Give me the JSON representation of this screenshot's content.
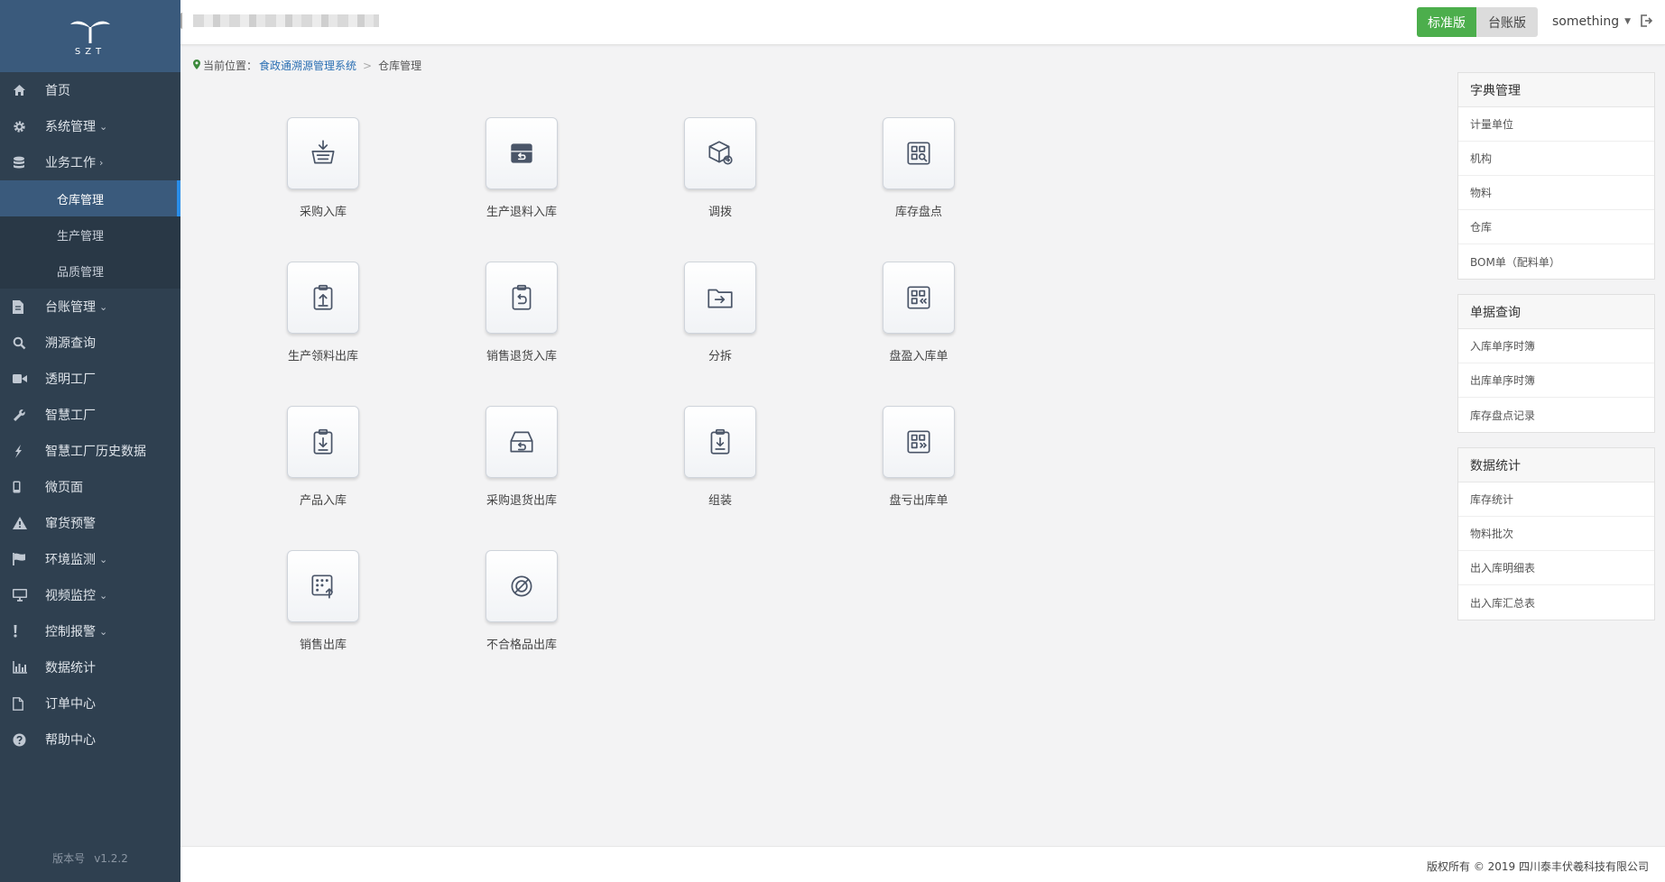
{
  "logo": {
    "text": "SZT"
  },
  "sidebar": {
    "items": [
      {
        "label": "首页",
        "icon": "home-icon",
        "arrow": ""
      },
      {
        "label": "系统管理",
        "icon": "gear-icon",
        "arrow": "⌄"
      },
      {
        "label": "业务工作",
        "icon": "database-icon",
        "arrow": "›"
      },
      {
        "label": "仓库管理",
        "sub": true,
        "active": true
      },
      {
        "label": "生产管理",
        "sub": true
      },
      {
        "label": "品质管理",
        "sub": true
      },
      {
        "label": "台账管理",
        "icon": "file-icon",
        "arrow": "⌄"
      },
      {
        "label": "溯源查询",
        "icon": "search-icon",
        "arrow": ""
      },
      {
        "label": "透明工厂",
        "icon": "video-icon",
        "arrow": ""
      },
      {
        "label": "智慧工厂",
        "icon": "wrench-icon",
        "arrow": ""
      },
      {
        "label": "智慧工厂历史数据",
        "icon": "flash-icon",
        "arrow": ""
      },
      {
        "label": "微页面",
        "icon": "mobile-icon",
        "arrow": ""
      },
      {
        "label": "窜货预警",
        "icon": "warning-icon",
        "arrow": ""
      },
      {
        "label": "环境监测",
        "icon": "flag-icon",
        "arrow": "⌄"
      },
      {
        "label": "视频监控",
        "icon": "monitor-icon",
        "arrow": "⌄"
      },
      {
        "label": "控制报警",
        "icon": "exclamation-icon",
        "arrow": "⌄"
      },
      {
        "label": "数据统计",
        "icon": "bar-chart-icon",
        "arrow": ""
      },
      {
        "label": "订单中心",
        "icon": "document-icon",
        "arrow": ""
      },
      {
        "label": "帮助中心",
        "icon": "help-icon",
        "arrow": ""
      }
    ],
    "version_label": "版本号",
    "version": "v1.2.2"
  },
  "header": {
    "standard_btn": "标准版",
    "ledger_btn": "台账版",
    "user": "something"
  },
  "breadcrumb": {
    "prefix": "当前位置：",
    "root": "食政通溯源管理系统",
    "separator": ">",
    "current": "仓库管理"
  },
  "tiles": [
    {
      "label": "采购入库",
      "icon": "basket-in-icon"
    },
    {
      "label": "生产退料入库",
      "icon": "inbox-return-icon"
    },
    {
      "label": "调拨",
      "icon": "box-transfer-icon"
    },
    {
      "label": "库存盘点",
      "icon": "grid-search-icon"
    },
    {
      "label": "生产领料出库",
      "icon": "clipboard-up-icon"
    },
    {
      "label": "销售退货入库",
      "icon": "clipboard-return-icon"
    },
    {
      "label": "分拆",
      "icon": "folder-arrow-icon"
    },
    {
      "label": "盘盈入库单",
      "icon": "grid-in-icon"
    },
    {
      "label": "产品入库",
      "icon": "clipboard-down-icon"
    },
    {
      "label": "采购退货出库",
      "icon": "tray-return-icon"
    },
    {
      "label": "组装",
      "icon": "clipboard-download-icon"
    },
    {
      "label": "盘亏出库单",
      "icon": "grid-out-icon"
    },
    {
      "label": "销售出库",
      "icon": "keypad-up-icon"
    },
    {
      "label": "不合格品出库",
      "icon": "forbidden-icon"
    }
  ],
  "panels": [
    {
      "title": "字典管理",
      "items": [
        "计量单位",
        "机构",
        "物料",
        "仓库",
        "BOM单（配料单）"
      ]
    },
    {
      "title": "单据查询",
      "items": [
        "入库单序时簿",
        "出库单序时簿",
        "库存盘点记录"
      ]
    },
    {
      "title": "数据统计",
      "items": [
        "库存统计",
        "物料批次",
        "出入库明细表",
        "出入库汇总表"
      ]
    }
  ],
  "footer": {
    "text": "版权所有 © 2019 四川泰丰伏羲科技有限公司"
  }
}
